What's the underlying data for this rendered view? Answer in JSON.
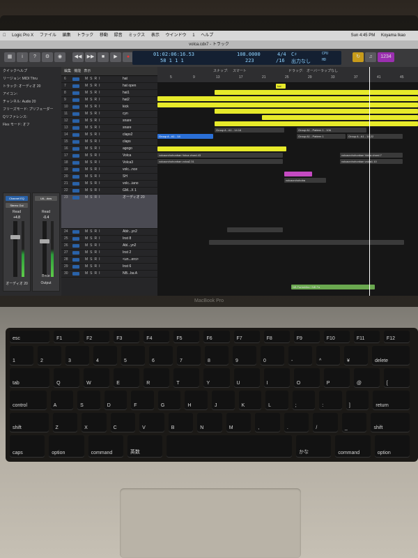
{
  "menubar": {
    "app": "Logic Pro X",
    "items": [
      "ファイル",
      "編集",
      "トラック",
      "移動",
      "録音",
      "ミックス",
      "表示",
      "ウインドウ",
      "1",
      "ヘルプ"
    ],
    "clock": "Sun 4:45 PM",
    "user": "Koyama Ikao"
  },
  "window": {
    "title": "volca.cdx7 - トラック"
  },
  "lcd": {
    "position": "01:02:06:16.53",
    "bars": "58 1 1 1",
    "tempo": "108.0000",
    "tempo2": "223",
    "signature": "4/4",
    "signature2": "/16",
    "key": "C♯",
    "output": "出力なし",
    "cpu": "CPU",
    "hd": "HD"
  },
  "inspector": {
    "items": [
      "クイックヘルプ",
      "リージョン: MIDI Thru",
      "トラック: オーディオ 20",
      "アイコン:",
      "チャンネル: Audio 20",
      "フリーズモード: プリフェーダー",
      "Qリファレンス:",
      "Flex モード: オフ"
    ],
    "strip1": {
      "name": "オーディオ 20",
      "eq": "Channel EQ",
      "out": "Stereo Out",
      "vol": "+4.8",
      "pan": "-20",
      "read": "Read"
    },
    "strip2": {
      "name": "Output",
      "eq": "UA...dow",
      "vol": "-0.4",
      "pan": "-2.9",
      "read": "Read",
      "bnce": "Bnce"
    }
  },
  "tracklist_header": {
    "edit": "編集",
    "func": "機能",
    "view": "表示"
  },
  "tracks": [
    {
      "num": "6",
      "name": "hat"
    },
    {
      "num": "7",
      "name": "hat open"
    },
    {
      "num": "8",
      "name": "hat1"
    },
    {
      "num": "9",
      "name": "hat2"
    },
    {
      "num": "10",
      "name": "kick"
    },
    {
      "num": "11",
      "name": "cyn"
    },
    {
      "num": "12",
      "name": "snare"
    },
    {
      "num": "13",
      "name": "snare"
    },
    {
      "num": "14",
      "name": "claps2"
    },
    {
      "num": "15",
      "name": "claps"
    },
    {
      "num": "16",
      "name": "agogo"
    },
    {
      "num": "17",
      "name": "Volca"
    },
    {
      "num": "18",
      "name": "Volca3"
    },
    {
      "num": "19",
      "name": "volc...nce"
    },
    {
      "num": "20",
      "name": "SH"
    },
    {
      "num": "21",
      "name": "volc...iano"
    },
    {
      "num": "22",
      "name": "GM...X 1"
    },
    {
      "num": "23",
      "name": "オーディオ 20"
    },
    {
      "num": "24",
      "name": "Ablr...yn2"
    },
    {
      "num": "25",
      "name": "Inst 8"
    },
    {
      "num": "26",
      "name": "Abl...yn2"
    },
    {
      "num": "27",
      "name": "Inst 2"
    },
    {
      "num": "28",
      "name": "<un...ero>"
    },
    {
      "num": "29",
      "name": "Inst 6"
    },
    {
      "num": "30",
      "name": "NB...ba A"
    }
  ],
  "ruler": {
    "snap_label": "スナップ:",
    "snap_value": "スマート",
    "drag_label": "ドラッグ:",
    "drag_value": "オーバーラップなし",
    "bars": [
      "5",
      "9",
      "13",
      "17",
      "21",
      "25",
      "29",
      "33",
      "37",
      "41",
      "45"
    ]
  },
  "regions": {
    "hat": "hat",
    "group_a": "Group A - A1 - 14",
    "group_a2": "Group A - A1 - 14.16",
    "group_pattern": "Group A1 - Pattern 1 - 106",
    "group_pattern2": "Group A1 - Pattern 1",
    "group_a3": "Group A - A1 - 14.22",
    "volca1": "volcacrchohonban Volca chord.43",
    "volca2": "volcacrchohonban volca2.31",
    "volca3": "volcacrchohonban volca2.34",
    "volca4": "volcacrchohonban Volca chord.7",
    "volca5": "volcacrchohonban volca1.10",
    "volca6": "volcacrchohoba",
    "nb": "NB Fantahiba I  NB Fa"
  },
  "laptop_label": "MacBook Pro",
  "keyboard": {
    "row0": [
      "esc",
      "F1",
      "F2",
      "F3",
      "F4",
      "F5",
      "F6",
      "F7",
      "F8",
      "F9",
      "F10",
      "F11",
      "F12"
    ],
    "row1": [
      "1",
      "2",
      "3",
      "4",
      "5",
      "6",
      "7",
      "8",
      "9",
      "0",
      "-",
      "^",
      "¥",
      "delete"
    ],
    "row2": [
      "tab",
      "Q",
      "W",
      "E",
      "R",
      "T",
      "Y",
      "U",
      "I",
      "O",
      "P",
      "@",
      "["
    ],
    "row3": [
      "control",
      "A",
      "S",
      "D",
      "F",
      "G",
      "H",
      "J",
      "K",
      "L",
      ";",
      ":",
      "]",
      "return"
    ],
    "row4": [
      "shift",
      "Z",
      "X",
      "C",
      "V",
      "B",
      "N",
      "M",
      ",",
      ".",
      "/",
      "_",
      "shift"
    ],
    "row5": [
      "caps",
      "option",
      "command",
      "英数",
      "",
      "かな",
      "command",
      "option"
    ]
  }
}
